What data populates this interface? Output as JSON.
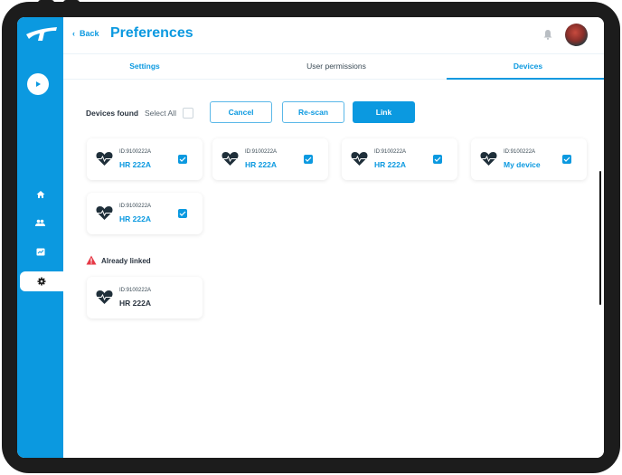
{
  "header": {
    "back_label": "Back",
    "title": "Preferences"
  },
  "tabs": [
    {
      "label": "Settings",
      "state": "inactive-link"
    },
    {
      "label": "User permissions",
      "state": "inactive"
    },
    {
      "label": "Devices",
      "state": "selected"
    }
  ],
  "toolbar": {
    "devices_found_label": "Devices found",
    "select_all_label": "Select All",
    "select_all_checked": false,
    "cancel_label": "Cancel",
    "rescan_label": "Re-scan",
    "link_label": "Link"
  },
  "devices_found": [
    {
      "id": "ID:9100222A",
      "name": "HR 222A",
      "checked": true
    },
    {
      "id": "ID:9100222A",
      "name": "HR 222A",
      "checked": true
    },
    {
      "id": "ID:9100222A",
      "name": "HR 222A",
      "checked": true
    },
    {
      "id": "ID:9100222A",
      "name": "My device",
      "checked": true
    },
    {
      "id": "ID:9100222A",
      "name": "HR 222A",
      "checked": true
    }
  ],
  "already_linked": {
    "label": "Already linked",
    "devices": [
      {
        "id": "ID:9100222A",
        "name": "HR 222A"
      }
    ]
  },
  "sidebar": {
    "items": [
      {
        "icon": "play-icon"
      },
      {
        "icon": "home-icon"
      },
      {
        "icon": "users-icon"
      },
      {
        "icon": "chart-icon"
      },
      {
        "icon": "gear-icon",
        "active": true
      }
    ]
  },
  "colors": {
    "brand": "#0b99e0",
    "text_dark": "#2a3440",
    "warning": "#e63946",
    "bezel": "#1c1c1c"
  }
}
